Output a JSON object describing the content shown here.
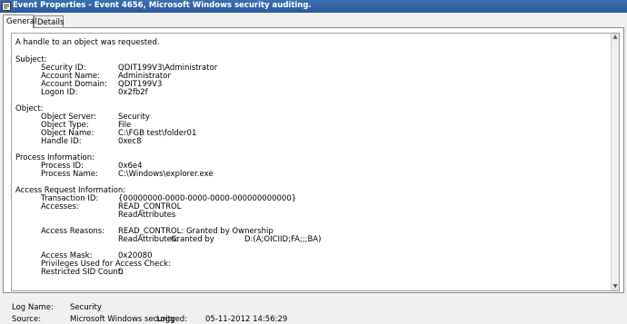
{
  "window": {
    "title": "Event Properties - Event 4656, Microsoft Windows security auditing."
  },
  "tabs": [
    {
      "label": "General"
    },
    {
      "label": "Details"
    }
  ],
  "description": {
    "headline": "A handle to an object was requested.",
    "subject": {
      "heading": "Subject:",
      "fields": [
        {
          "label": "Security ID:",
          "value": "QDIT199V3\\Administrator"
        },
        {
          "label": "Account Name:",
          "value": "Administrator"
        },
        {
          "label": "Account Domain:",
          "value": "QDIT199V3"
        },
        {
          "label": "Logon ID:",
          "value": "0x2fb2f"
        }
      ]
    },
    "object": {
      "heading": "Object:",
      "fields": [
        {
          "label": "Object Server:",
          "value": "Security"
        },
        {
          "label": "Object Type:",
          "value": "File"
        },
        {
          "label": "Object Name:",
          "value": "C:\\FGB test\\folder01"
        },
        {
          "label": "Handle ID:",
          "value": "0xec8"
        }
      ]
    },
    "process": {
      "heading": "Process Information:",
      "fields": [
        {
          "label": "Process ID:",
          "value": "0x6e4"
        },
        {
          "label": "Process Name:",
          "value": "C:\\Windows\\explorer.exe"
        }
      ]
    },
    "access": {
      "heading": "Access Request Information:",
      "transaction_label": "Transaction ID:",
      "transaction_value": "{00000000-0000-0000-0000-000000000000}",
      "accesses_label": "Accesses:",
      "accesses": [
        "READ_CONTROL",
        "ReadAttributes"
      ],
      "reasons_label": "Access Reasons:",
      "reason1": "READ_CONTROL: Granted by Ownership",
      "reason2_name": "ReadAttributes:",
      "reason2_granted": "Granted by",
      "reason2_acl": "D:(A;OICIID;FA;;;BA)",
      "mask_label": "Access Mask:",
      "mask_value": "0x20080",
      "privileges_label": "Privileges Used for Access Check:",
      "privileges_value": "-",
      "sid_label": "Restricted SID Count:",
      "sid_value": "0"
    }
  },
  "footer": {
    "log_name_label": "Log Name:",
    "log_name_value": "Security",
    "source_label": "Source:",
    "source_value": "Microsoft Windows security",
    "logged_label": "Logged:",
    "logged_value": "05-11-2012 14:56:29"
  },
  "colors": {
    "titlebar": "#2a5a9c",
    "panel_bg": "#ffffff",
    "window_bg": "#f0f0f0"
  }
}
